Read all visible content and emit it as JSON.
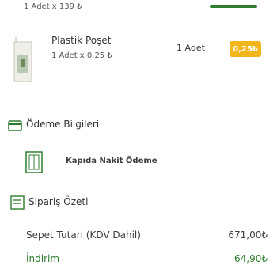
{
  "previous_item": {
    "qty_text": "1 Adet x 139 ₺"
  },
  "item": {
    "name": "Plastik Poşet",
    "unit_text": "1 Adet x 0.25 ₺",
    "qty_label": "1 Adet",
    "price": "0,25₺"
  },
  "payment": {
    "title": "Ödeme Bilgileri",
    "method": "Kapıda Nakit Ödeme"
  },
  "summary": {
    "title": "Sipariş Özeti",
    "rows": [
      {
        "label": "Sepet Tutarı (KDV Dahil)",
        "value": "671,00₺"
      },
      {
        "label": "İndirim",
        "value": "64,90₺"
      }
    ]
  },
  "colors": {
    "accent_green": "#2e7d2e",
    "price_badge": "#f2b51a",
    "text": "#333333"
  },
  "icons": {
    "product": "plastic-bag-thumbnail",
    "payment": "credit-card-icon",
    "method": "cash-on-delivery-icon",
    "summary": "receipt-icon"
  }
}
